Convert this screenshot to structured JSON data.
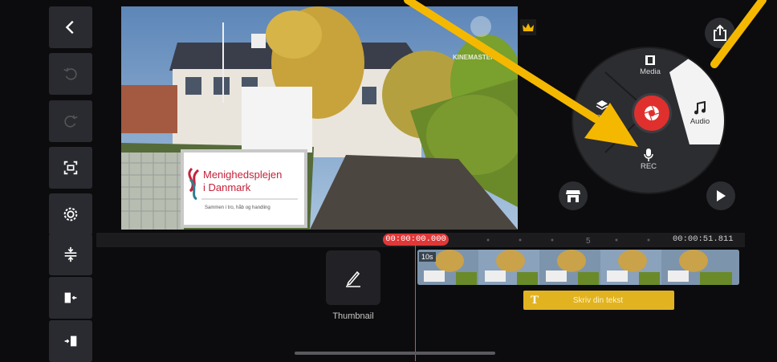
{
  "preview": {
    "watermark": "KINEMASTER",
    "sign_title_line1": "Menighedsplejen",
    "sign_title_line2": "i Danmark",
    "sign_subtitle": "Sammen i tro, håb og handling"
  },
  "menu": {
    "media_label": "Media",
    "layer_label": "Layer",
    "audio_label": "Audio",
    "rec_label": "REC"
  },
  "timeline": {
    "current_time": "00:00:00.000",
    "total_time": "00:00:51.811",
    "ruler_mark": "5",
    "clip_tag": "10s",
    "text_clip_label": "Skriv din tekst",
    "thumbnail_label": "Thumbnail"
  },
  "colors": {
    "accent_red": "#e0302e",
    "annotation_arrow": "#f5b800",
    "text_clip": "#e1b320",
    "toolbar_button": "#2a2b30"
  },
  "icons": {
    "toolbar": [
      "back-icon",
      "undo-icon",
      "redo-icon",
      "capture-frame-icon",
      "settings-icon",
      "expand-tracks-icon",
      "clip-to-playhead-icon",
      "playhead-to-clip-icon"
    ],
    "menu": [
      "media-icon",
      "layer-icon",
      "audio-icon",
      "mic-icon",
      "camera-icon"
    ],
    "other": [
      "export-icon",
      "store-icon",
      "play-icon",
      "pen-icon",
      "crown-icon",
      "text-icon"
    ]
  }
}
